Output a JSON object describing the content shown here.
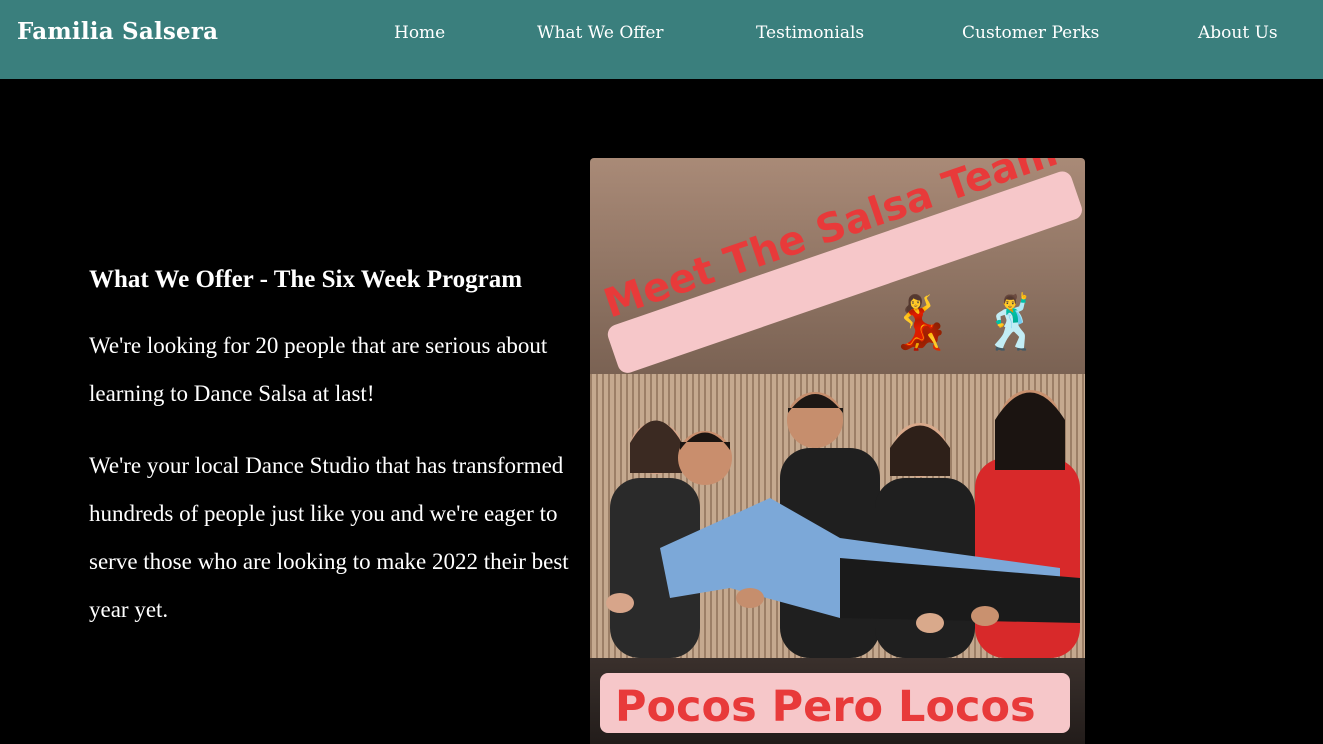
{
  "brand": "Familia Salsera",
  "nav": {
    "home": "Home",
    "offer": "What We Offer",
    "testimonials": "Testimonials",
    "perks": "Customer Perks",
    "about": "About Us"
  },
  "main": {
    "heading": "What We Offer - The Six Week Program",
    "paragraph1": "We're looking for 20 people that are serious about learning to Dance Salsa at last!",
    "paragraph2": "We're your local Dance Studio that has transformed hundreds of people just like you and we're eager to serve those who are looking to make 2022 their best year yet."
  },
  "image": {
    "banner_top": "Meet The Salsa Team",
    "banner_bottom": "Pocos Pero Locos",
    "dancer_icons": [
      "💃",
      "🕺"
    ]
  },
  "colors": {
    "navbar": "#3a7f7d",
    "background": "#000000",
    "banner_text": "#e83a3a",
    "banner_bg": "#f6c7c9"
  }
}
